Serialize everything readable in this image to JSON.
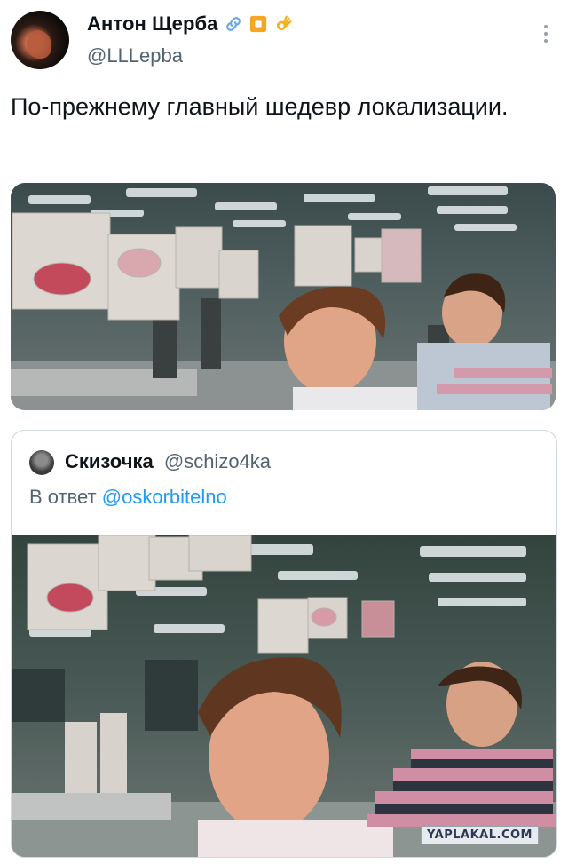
{
  "tweet": {
    "display_name": "Антон Щерба",
    "handle": "@LLLepba",
    "text": "По-прежнему главный шедевр локализации.",
    "badges": [
      "link-icon",
      "orange-square-icon",
      "ok-hand-icon"
    ],
    "media_alt_icon": "office-scene-image"
  },
  "quoted": {
    "display_name": "Скизочка",
    "handle": "@schizo4ka",
    "reply_prefix": "В ответ",
    "reply_to": "@oskorbitelno"
  },
  "watermark": "YAPLAKAL.COM",
  "colors": {
    "accent": "#1d9bf0",
    "secondary_text": "#536471",
    "border": "#cfd9de"
  }
}
